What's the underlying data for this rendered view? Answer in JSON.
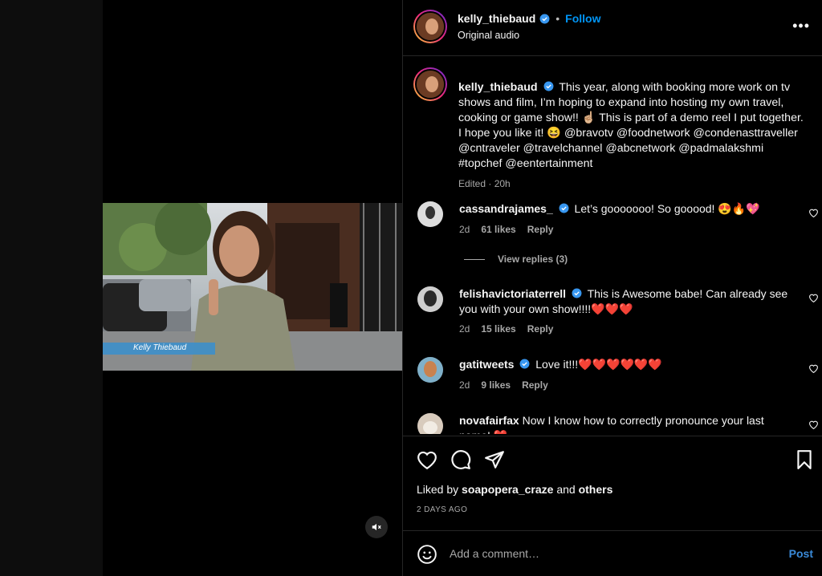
{
  "post": {
    "username": "kelly_thiebaud",
    "follow_label": "Follow",
    "separator": "•",
    "subtitle": "Original audio",
    "more_label": "•••",
    "caption": "This year, along with booking more work on tv shows and film, I’m hoping to expand into hosting my own travel, cooking or game show!! ☝🏼 This is part of a demo reel I put together. I hope you like it! 😆 @bravotv @foodnetwork @condenasttraveller @cntraveler @travelchannel @abcnetwork @padmalakshmi #topchef @eentertainment",
    "caption_meta": "Edited · 20h",
    "video_caption": "Kelly Thiebaud"
  },
  "comments": [
    {
      "username": "cassandrajames_",
      "text": "Let’s gooooooo! So gooood! 😍🔥💖",
      "age": "2d",
      "likes": "61 likes",
      "reply": "Reply"
    },
    {
      "username": "felishavictoriaterrell",
      "text": "This is Awesome babe! Can already see you with your own show!!!!❤️❤️❤️",
      "age": "2d",
      "likes": "15 likes",
      "reply": "Reply"
    },
    {
      "username": "gatitweets",
      "text": "Love it!!!❤️❤️❤️❤️❤️❤️",
      "age": "2d",
      "likes": "9 likes",
      "reply": "Reply"
    },
    {
      "username": "novafairfax",
      "text": "Now I know how to correctly pronounce your last name! ❤️"
    }
  ],
  "view_replies": "View replies (3)",
  "likes": {
    "prefix": "Liked by",
    "user": "soapopera_craze",
    "and": "and",
    "others": "others",
    "time": "2 DAYS AGO"
  },
  "composer": {
    "placeholder": "Add a comment…",
    "post_label": "Post"
  },
  "colors": {
    "accent": "#0095f6",
    "verified": "#3897f0",
    "background": "#000000",
    "muted": "#a8a8a8"
  },
  "icons": [
    "verified-badge-icon",
    "heart-icon",
    "comment-icon",
    "share-icon",
    "bookmark-icon",
    "emoji-icon",
    "mute-icon",
    "more-icon"
  ]
}
